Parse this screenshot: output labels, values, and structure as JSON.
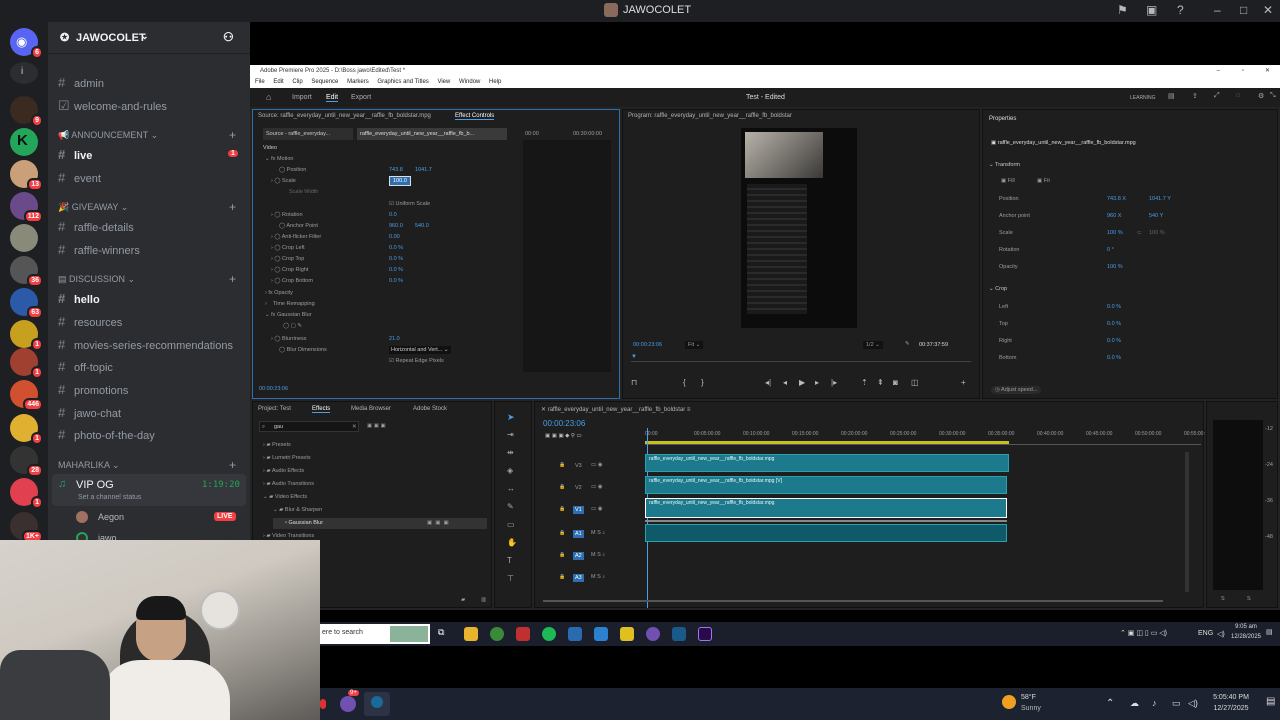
{
  "discord": {
    "window_title": "JAWOCOLET",
    "server_name": "JAWOCOLET",
    "rail_badges": [
      "6",
      "9",
      "13",
      "112",
      "36",
      "63",
      "1",
      "1",
      "446",
      "1",
      "28",
      "1",
      "1K+"
    ],
    "channels": {
      "admin": "admin",
      "welcome": "welcome-and-rules",
      "cat_announcement": "ANNOUNCEMENT",
      "live": "live",
      "live_badge": "1",
      "event": "event",
      "cat_giveaway": "GIVEAWAY",
      "raffle_details": "raffle-details",
      "raffle_winners": "raffle-winners",
      "cat_discussion": "DISCUSSION",
      "hello": "hello",
      "resources": "resources",
      "movies": "movies-series-recommendations",
      "offtopic": "off-topic",
      "promotions": "promotions",
      "jawochat": "jawo-chat",
      "photo": "photo-of-the-day",
      "cat_maharlika": "MAHARLIKA",
      "vip": "VIP OG",
      "vip_time": "1:19:20",
      "vip_status": "Set a channel status",
      "user1": "Aegon",
      "user1_badge": "LIVE",
      "user2": "jawo"
    }
  },
  "premiere": {
    "title": "Adobe Premiere Pro 2025 - D:\\Boss jawo\\Edited\\Test *",
    "menu": [
      "File",
      "Edit",
      "Clip",
      "Sequence",
      "Markers",
      "Graphics and Titles",
      "View",
      "Window",
      "Help"
    ],
    "tabs": {
      "home": "Home",
      "import": "Import",
      "edit": "Edit",
      "export": "Export",
      "project_title": "Test - Edited",
      "learning": "LEARNING"
    },
    "source_header": "Source: raffle_everyday_until_new_year__raffle_fb_boldstar.mpg",
    "effect_controls": "Effect Controls",
    "source_tab1": "Source - raffle_everyday...",
    "source_tab2": "raffle_everyday_until_new_year__raffle_fb_b...",
    "ec_time1": "00:00",
    "ec_time2": "00:30:00:00",
    "ec_clip": "raffle_everyday_until_new_yea",
    "ec_section": "Video",
    "effects": {
      "motion": "Motion",
      "position": "Position",
      "position_x": "743.8",
      "position_y": "1041.7",
      "scale": "Scale",
      "scale_val": "100.0",
      "scale_width": "Scale Width",
      "uniform": "Uniform Scale",
      "rotation": "Rotation",
      "rotation_val": "0.0",
      "anchor": "Anchor Point",
      "anchor_x": "960.0",
      "anchor_y": "540.0",
      "antiflicker": "Anti-flicker Filter",
      "antiflicker_val": "0.00",
      "crop_left": "Crop Left",
      "crop_left_val": "0.0 %",
      "crop_top": "Crop Top",
      "crop_top_val": "0.0 %",
      "crop_right": "Crop Right",
      "crop_right_val": "0.0 %",
      "crop_bottom": "Crop Bottom",
      "crop_bottom_val": "0.0 %",
      "opacity": "Opacity",
      "time_remap": "Time Remapping",
      "gaussian": "Gaussian Blur",
      "blurriness": "Blurriness",
      "blurriness_val": "21.0",
      "blur_dim": "Blur Dimensions",
      "blur_dim_val": "Horizontal and Vert...",
      "repeat_edge": "Repeat Edge Pixels"
    },
    "ec_timecode": "00:00:23:06",
    "program": {
      "header": "Program: raffle_everyday_until_new_year__raffle_fb_boldstar",
      "timecode": "00:00:23:06",
      "fit": "Fit",
      "res": "1/2",
      "duration": "00:37:37:59"
    },
    "properties": {
      "header": "Properties",
      "clip": "raffle_everyday_until_new_year__raffle_fb_boldstar.mpg",
      "transform": "Transform",
      "fill": "Fill",
      "fit": "Fit",
      "position": "Position",
      "position_x": "743.8 X",
      "position_y": "1041.7 Y",
      "anchor": "Anchor point",
      "anchor_x": "960 X",
      "anchor_y": "540 Y",
      "scale": "Scale",
      "scale_val": "100 %",
      "scale_val2": "100 %",
      "rotation": "Rotation",
      "rotation_val": "0 °",
      "opacity": "Opacity",
      "opacity_val": "100 %",
      "crop": "Crop",
      "left": "Left",
      "left_val": "0.0 %",
      "top": "Top",
      "top_val": "0.0 %",
      "right": "Right",
      "right_val": "0.0 %",
      "bottom": "Bottom",
      "bottom_val": "0.0 %",
      "adjust_speed": "Adjust speed..."
    },
    "project": {
      "tabs": [
        "Project: Test",
        "Effects",
        "Media Browser",
        "Adobe Stock"
      ],
      "search": "gau",
      "tree": [
        "Presets",
        "Lumetri Presets",
        "Audio Effects",
        "Audio Transitions",
        "Video Effects",
        "Blur & Sharpen",
        "Gaussian Blur",
        "Video Transitions"
      ]
    },
    "timeline": {
      "tab": "raffle_everyday_until_new_year__raffle_fb_boldstar",
      "timecode": "00:00:23:06",
      "ruler": [
        "00:00",
        "00:05:00:00",
        "00:10:00:00",
        "00:15:00:00",
        "00:20:00:00",
        "00:25:00:00",
        "00:30:00:00",
        "00:35:00:00",
        "00:40:00:00",
        "00:45:00:00",
        "00:50:00:00",
        "00:55:00:"
      ],
      "tracks": [
        "V3",
        "V2",
        "V1",
        "A1",
        "A2",
        "A3"
      ],
      "clip_v3": "raffle_everyday_until_new_year__raffle_fb_boldstar.mpg",
      "clip_v2": "raffle_everyday_until_new_year__raffle_fb_boldstar.mpg [V]",
      "clip_v1": "raffle_everyday_until_new_year__raffle_fb_boldstar.mpg",
      "meter": [
        "S",
        "S"
      ]
    }
  },
  "win_inner": {
    "search": "ere to search",
    "lang": "ENG",
    "time": "9:05 am",
    "date": "12/28/2025"
  },
  "win_outer": {
    "temp": "58°F",
    "weather": "Sunny",
    "time": "5:05:40 PM",
    "date": "12/27/2025",
    "badge": "9+"
  }
}
